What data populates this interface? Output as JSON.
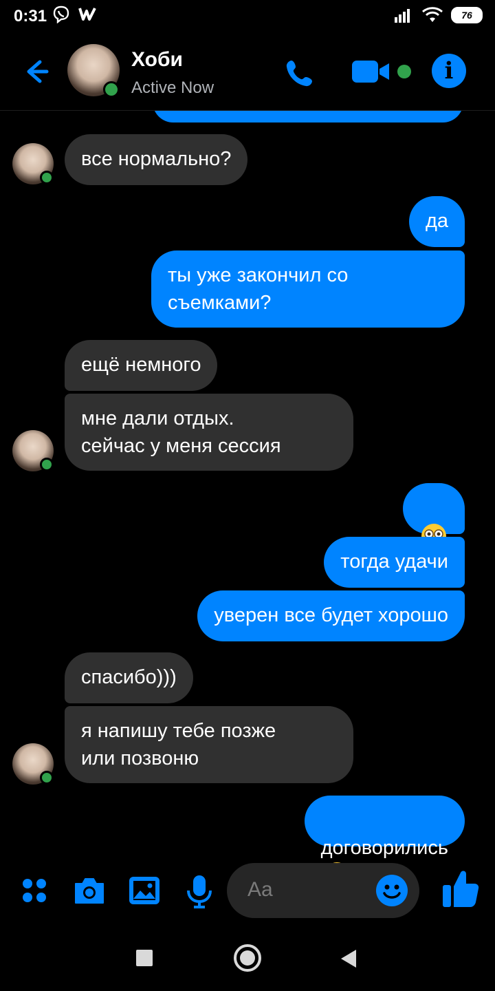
{
  "status_bar": {
    "time": "0:31",
    "battery": "76"
  },
  "header": {
    "contact_name": "Хоби",
    "status": "Active Now"
  },
  "messages": [
    {
      "side": "in",
      "text": "все нормально?"
    },
    {
      "side": "out",
      "text": "да"
    },
    {
      "side": "out",
      "text": "ты уже закончил со\nсъемками?"
    },
    {
      "side": "in",
      "text": "ещё немного"
    },
    {
      "side": "in",
      "text": "мне дали отдых.\nсейчас у меня сессия"
    },
    {
      "side": "out",
      "text": "",
      "emoji": "flushed-face"
    },
    {
      "side": "out",
      "text": "тогда удачи"
    },
    {
      "side": "out",
      "text": "уверен все будет хорошо"
    },
    {
      "side": "in",
      "text": "спасибо)))"
    },
    {
      "side": "in",
      "text": "я напишу тебе позже\nили позвоню"
    },
    {
      "side": "out",
      "text": "договорились",
      "emoji": "winking-face-with-tongue"
    }
  ],
  "composer": {
    "placeholder": "Aa"
  },
  "colors": {
    "accent": "#0084ff",
    "incoming_bubble": "#303030",
    "online": "#31a24c",
    "background": "#000000"
  },
  "icons": [
    "back-arrow-icon",
    "phone-icon",
    "video-camera-icon",
    "info-icon",
    "apps-grid-icon",
    "camera-icon",
    "image-icon",
    "microphone-icon",
    "emoji-icon",
    "thumbs-up-icon"
  ]
}
